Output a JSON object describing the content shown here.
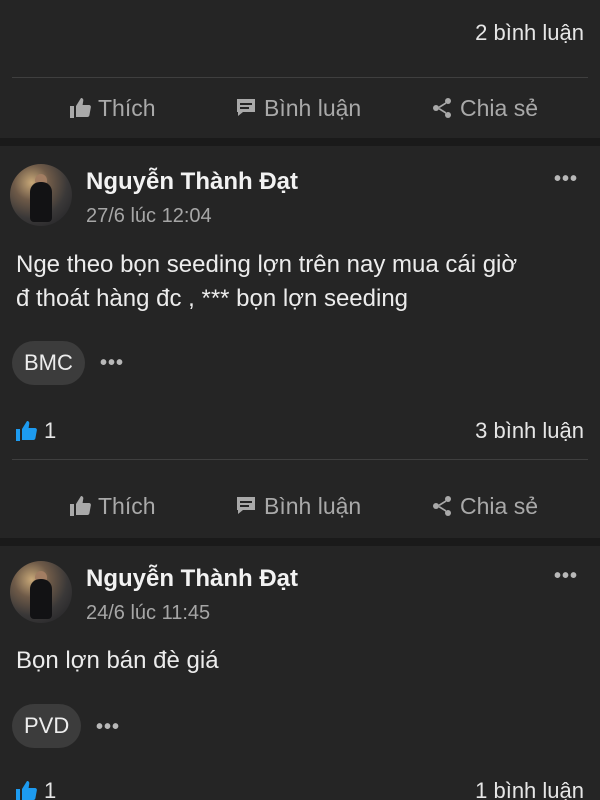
{
  "post_top": {
    "comments": "2 bình luận",
    "actions": {
      "like": "Thích",
      "comment": "Bình luận",
      "share": "Chia sẻ"
    }
  },
  "posts": [
    {
      "author": "Nguyễn Thành Đạt",
      "time": "27/6 lúc 12:04",
      "text_line1": "Nge theo bọn seeding lợn trên nay mua cái giờ",
      "text_line2": "đ thoát hàng đc , *** bọn lợn seeding",
      "tag": "BMC",
      "likes": "1",
      "comments": "3 bình luận",
      "actions": {
        "like": "Thích",
        "comment": "Bình luận",
        "share": "Chia sẻ"
      }
    },
    {
      "author": "Nguyễn Thành Đạt",
      "time": "24/6 lúc 11:45",
      "text_line1": "Bọn lợn bán đè giá",
      "tag": "PVD",
      "likes": "1",
      "comments": "1 bình luận"
    }
  ],
  "more_glyph": "•••",
  "colors": {
    "background": "#1a1a1a",
    "card": "#252525",
    "like_blue": "#1d9bf0",
    "muted": "#a9a9a9"
  },
  "icons": [
    "thumbs-up-icon",
    "comment-icon",
    "share-icon",
    "more-icon"
  ]
}
